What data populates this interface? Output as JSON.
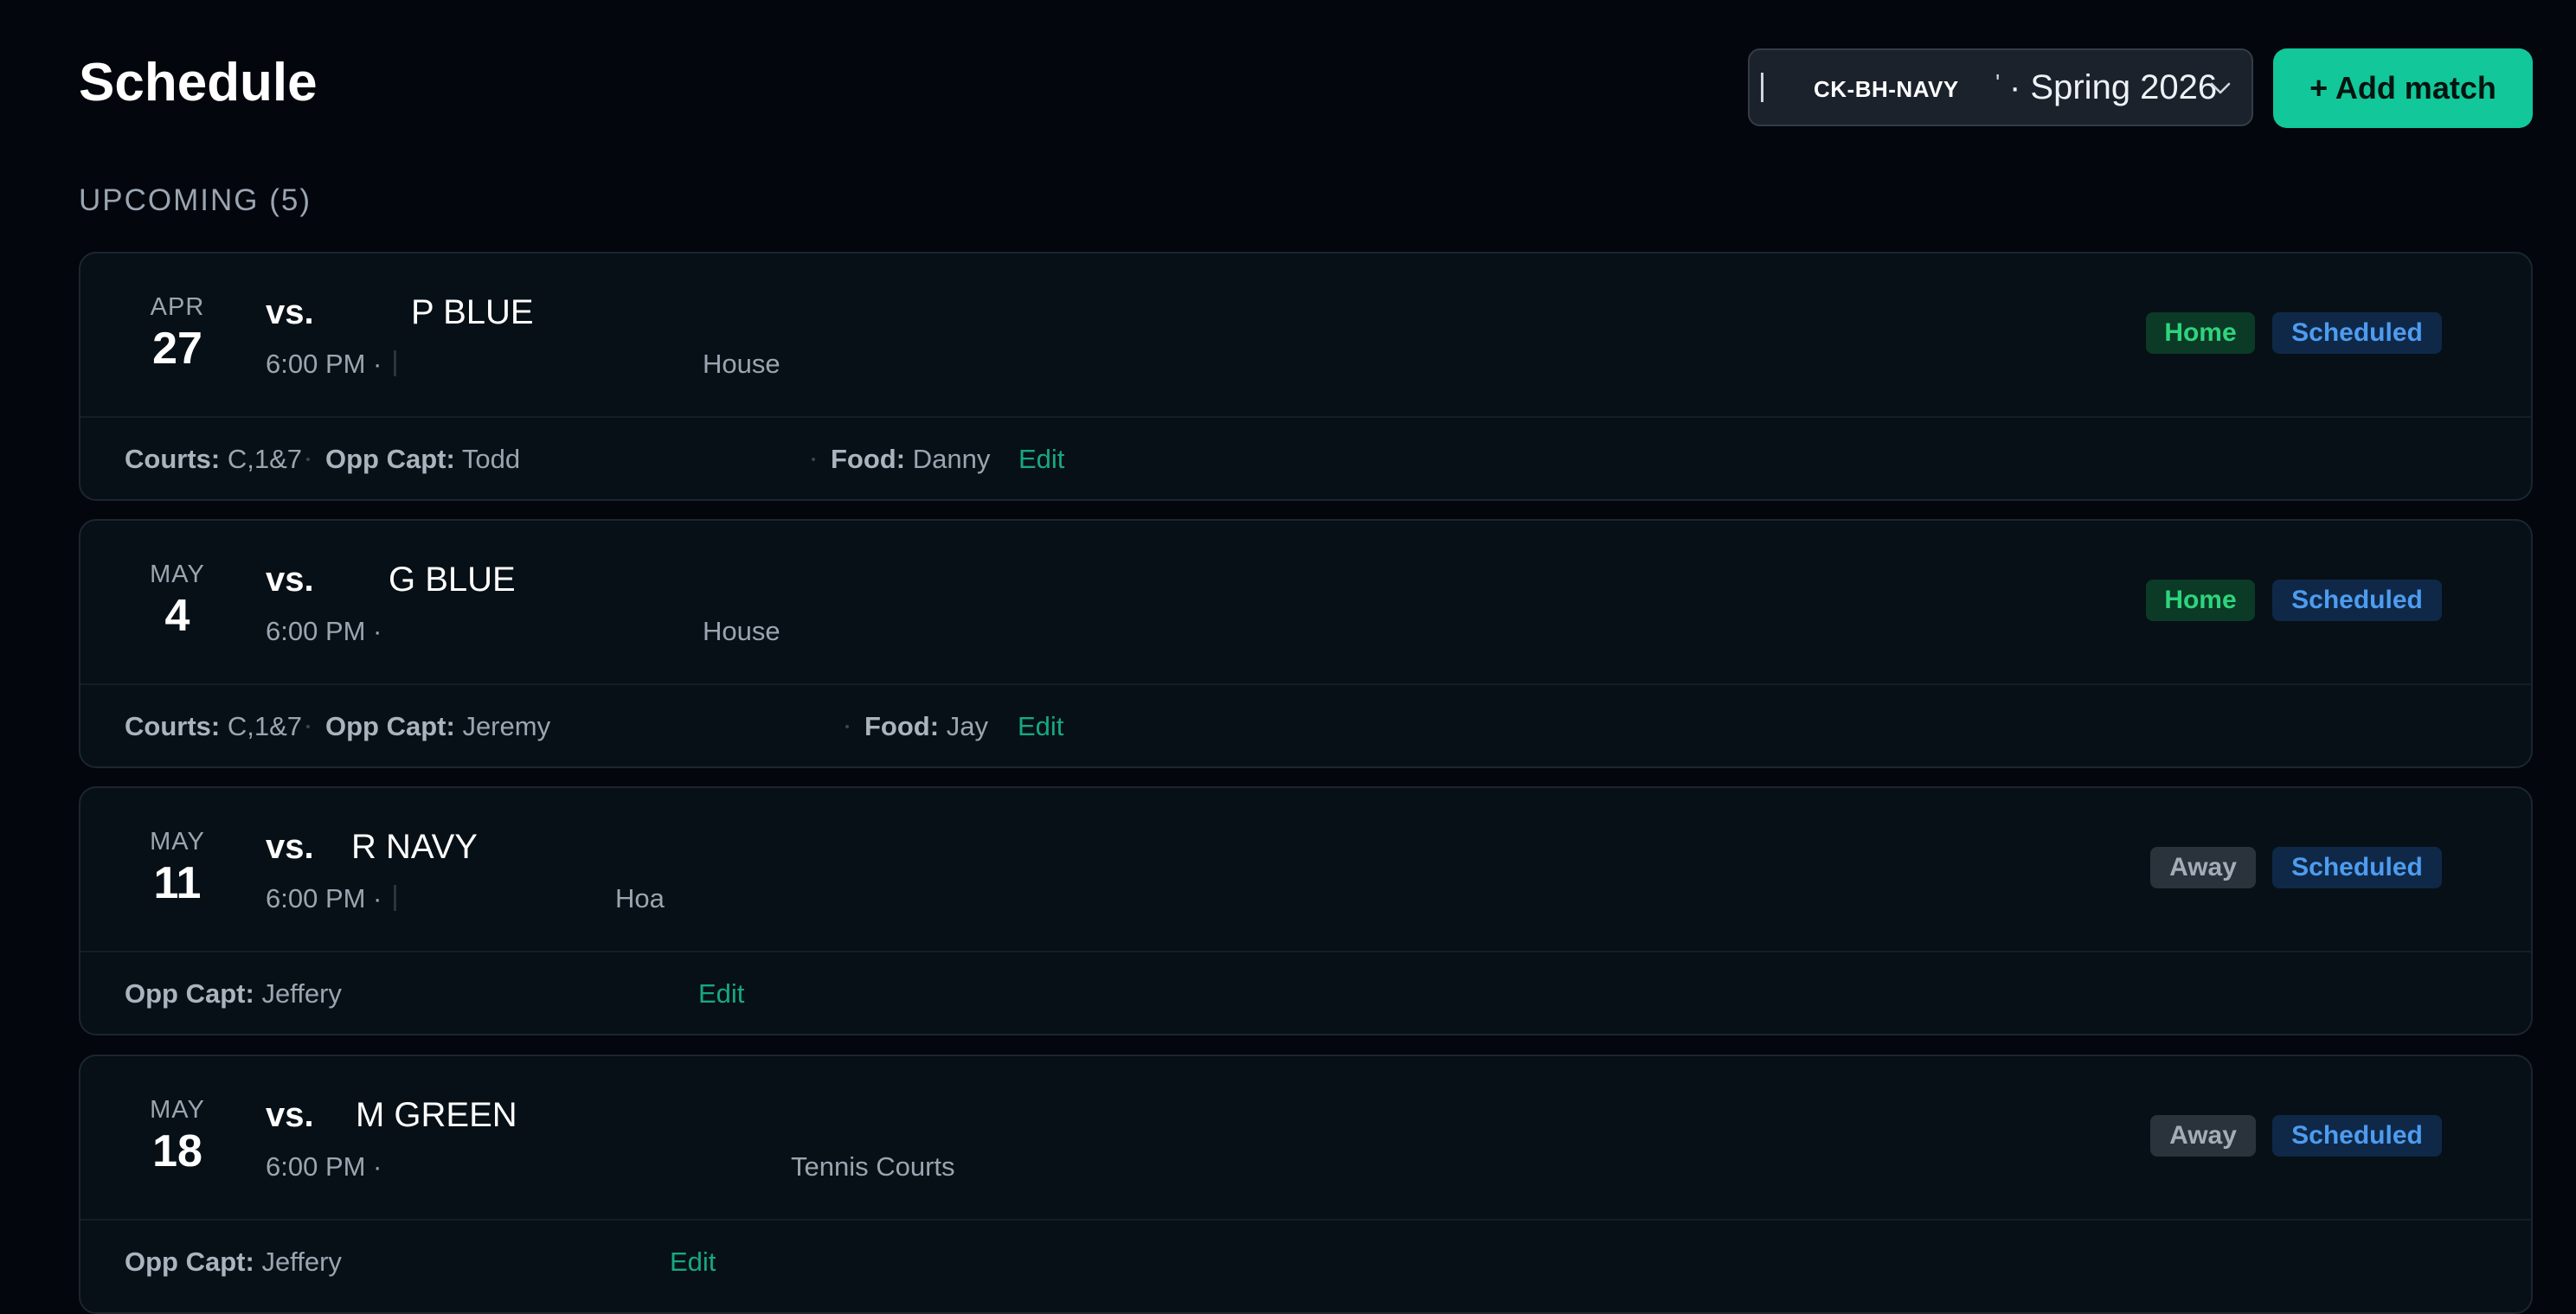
{
  "header": {
    "title": "Schedule",
    "team_select": {
      "team_code": "CK-BH-NAVY",
      "tick": "'",
      "season": "· Spring 2026"
    },
    "add_match_label": "+ Add match"
  },
  "upcoming": {
    "label": "UPCOMING (5)",
    "matches": [
      {
        "month": "APR",
        "day": "27",
        "vs": "vs.",
        "opponent": "P BLUE",
        "time": "6:00 PM ·",
        "venue": "House",
        "home_away": "Home",
        "status": "Scheduled",
        "courts_label": "Courts:",
        "courts": "C,1&7",
        "capt_label": "Opp Capt:",
        "capt": "Todd",
        "food_label": "Food:",
        "food": "Danny",
        "edit": "Edit"
      },
      {
        "month": "MAY",
        "day": "4",
        "vs": "vs.",
        "opponent": "G BLUE",
        "time": "6:00 PM ·",
        "venue": "House",
        "home_away": "Home",
        "status": "Scheduled",
        "courts_label": "Courts:",
        "courts": "C,1&7",
        "capt_label": "Opp Capt:",
        "capt": "Jeremy",
        "food_label": "Food:",
        "food": "Jay",
        "edit": "Edit"
      },
      {
        "month": "MAY",
        "day": "11",
        "vs": "vs.",
        "opponent": "R NAVY",
        "time": "6:00 PM ·",
        "venue": "Hoa",
        "home_away": "Away",
        "status": "Scheduled",
        "capt_label": "Opp Capt:",
        "capt": "Jeffery",
        "edit": "Edit"
      },
      {
        "month": "MAY",
        "day": "18",
        "vs": "vs.",
        "opponent": "M GREEN",
        "time": "6:00 PM ·",
        "venue": "Tennis Courts",
        "home_away": "Away",
        "status": "Scheduled",
        "capt_label": "Opp Capt:",
        "capt": "Jeffery",
        "edit": "Edit"
      }
    ]
  },
  "colors": {
    "background": "#03060c",
    "card": "#071016",
    "accent": "#12c79a",
    "home_badge": "#2ed47c",
    "scheduled_badge": "#4d9cf0"
  }
}
